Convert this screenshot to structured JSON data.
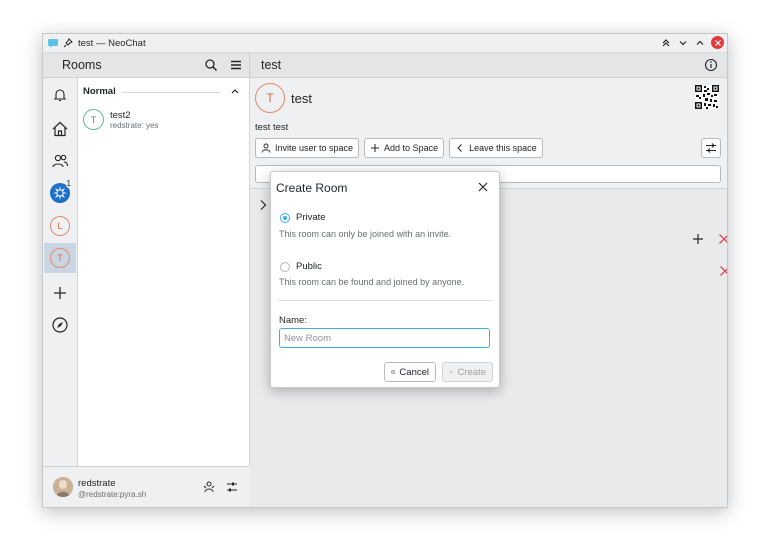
{
  "window": {
    "title": "test — NeoChat"
  },
  "header": {
    "rooms_title": "Rooms",
    "room_title": "test"
  },
  "spaces": {
    "items": [
      {
        "name": "notifications",
        "icon": "bell-icon"
      },
      {
        "name": "home",
        "icon": "home-icon"
      },
      {
        "name": "direct-messages",
        "icon": "people-icon"
      },
      {
        "name": "kde",
        "badge": "1"
      },
      {
        "name": "L",
        "initial": "L"
      },
      {
        "name": "T",
        "initial": "T",
        "active": true
      },
      {
        "name": "create-space",
        "icon": "plus-icon"
      },
      {
        "name": "explore",
        "icon": "compass-icon"
      }
    ]
  },
  "roomlist": {
    "section_label": "Normal",
    "rooms": [
      {
        "initial": "T",
        "name": "test2",
        "subtitle": "redstrate: yes"
      }
    ]
  },
  "user": {
    "name": "redstrate",
    "id": "@redstrate:pyra.sh"
  },
  "room": {
    "avatar_initial": "T",
    "name": "test",
    "topic": "test test",
    "actions": {
      "invite": "Invite user to space",
      "add": "Add to Space",
      "leave": "Leave this space"
    }
  },
  "dialog": {
    "title": "Create Room",
    "private_label": "Private",
    "private_desc": "This room can only be joined with an invite.",
    "public_label": "Public",
    "public_desc": "This room can be found and joined by anyone.",
    "name_label": "Name:",
    "name_placeholder": "New Room",
    "name_value": "",
    "cancel_label": "Cancel",
    "create_label": "Create",
    "selected": "private"
  },
  "colors": {
    "accent": "#3daee9",
    "close": "#e0383c",
    "reject": "#da4453"
  }
}
